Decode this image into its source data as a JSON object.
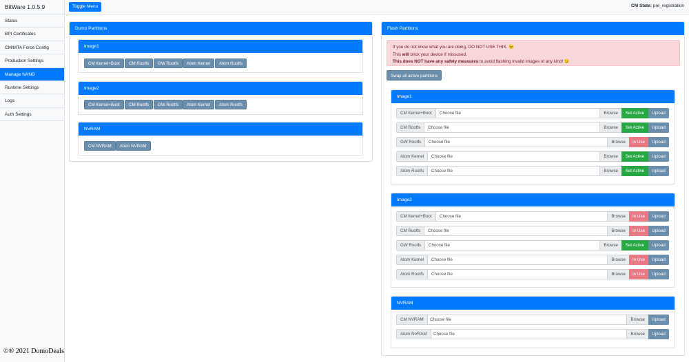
{
  "app": {
    "brand": "BitWare 1.0.5.9"
  },
  "sidebar": {
    "items": [
      {
        "label": "Status"
      },
      {
        "label": "BPI Certificates"
      },
      {
        "label": "CM/MTA Force Config"
      },
      {
        "label": "Production Settings"
      },
      {
        "label": "Manage NAND",
        "active": true
      },
      {
        "label": "Runtime Settings"
      },
      {
        "label": "Logs"
      },
      {
        "label": "Auth Settings"
      }
    ]
  },
  "copyright": "©® 2021 DomoDeals",
  "topbar": {
    "toggle_label": "Toggle Menu",
    "cm_state_label": "CM State:",
    "cm_state_value": "pre_registration"
  },
  "dump": {
    "title": "Dump Partitions",
    "image1": {
      "title": "Image1",
      "buttons": [
        "CM Kernel+Boot",
        "CM Rootfs",
        "GW Rootfs",
        "Atom Kernel",
        "Atom Rootfs"
      ]
    },
    "image2": {
      "title": "Image2",
      "buttons": [
        "CM Kernel+Boot",
        "CM Rootfs",
        "GW Rootfs",
        "Atom Kernel",
        "Atom Rootfs"
      ]
    },
    "nvram": {
      "title": "NVRAM",
      "buttons": [
        "CM NVRAM",
        "Atom NVRAM"
      ]
    }
  },
  "flash": {
    "title": "Flash Partitions",
    "warning": {
      "line1": "If you do not know what you are doing, DO NOT USE THIS. 😉",
      "line2_pre": "This ",
      "line2_bold": "will",
      "line2_post": " brick your device if missused.",
      "line3_bold": "This does NOT have any safety measures",
      "line3_post": " to avoid flashing invalid images of any kind! 😉"
    },
    "swap_label": "Swap all active partitions",
    "choose_file": "Choose file",
    "browse": "Browse",
    "upload": "Upload",
    "image1": {
      "title": "Image1",
      "rows": [
        {
          "label": "CM Kernel+Boot",
          "state": "Set Active"
        },
        {
          "label": "CM Rootfs",
          "state": "Set Active"
        },
        {
          "label": "GW Rootfs",
          "state": "In Use"
        },
        {
          "label": "Atom Kernel",
          "state": "Set Active"
        },
        {
          "label": "Atom Rootfs",
          "state": "Set Active"
        }
      ]
    },
    "image2": {
      "title": "Image2",
      "rows": [
        {
          "label": "CM Kernel+Boot",
          "state": "In Use"
        },
        {
          "label": "CM Rootfs",
          "state": "In Use"
        },
        {
          "label": "GW Rootfs",
          "state": "Set Active"
        },
        {
          "label": "Atom Kernel",
          "state": "In Use"
        },
        {
          "label": "Atom Rootfs",
          "state": "In Use"
        }
      ]
    },
    "nvram": {
      "title": "NVRAM",
      "rows": [
        {
          "label": "CM NVRAM"
        },
        {
          "label": "Atom NVRAM"
        }
      ]
    }
  },
  "colors": {
    "primary": "#007bff",
    "success": "#28a745",
    "danger_light": "#e77a84",
    "secondary": "#6c8ead",
    "alert_bg": "#f8d7da"
  }
}
